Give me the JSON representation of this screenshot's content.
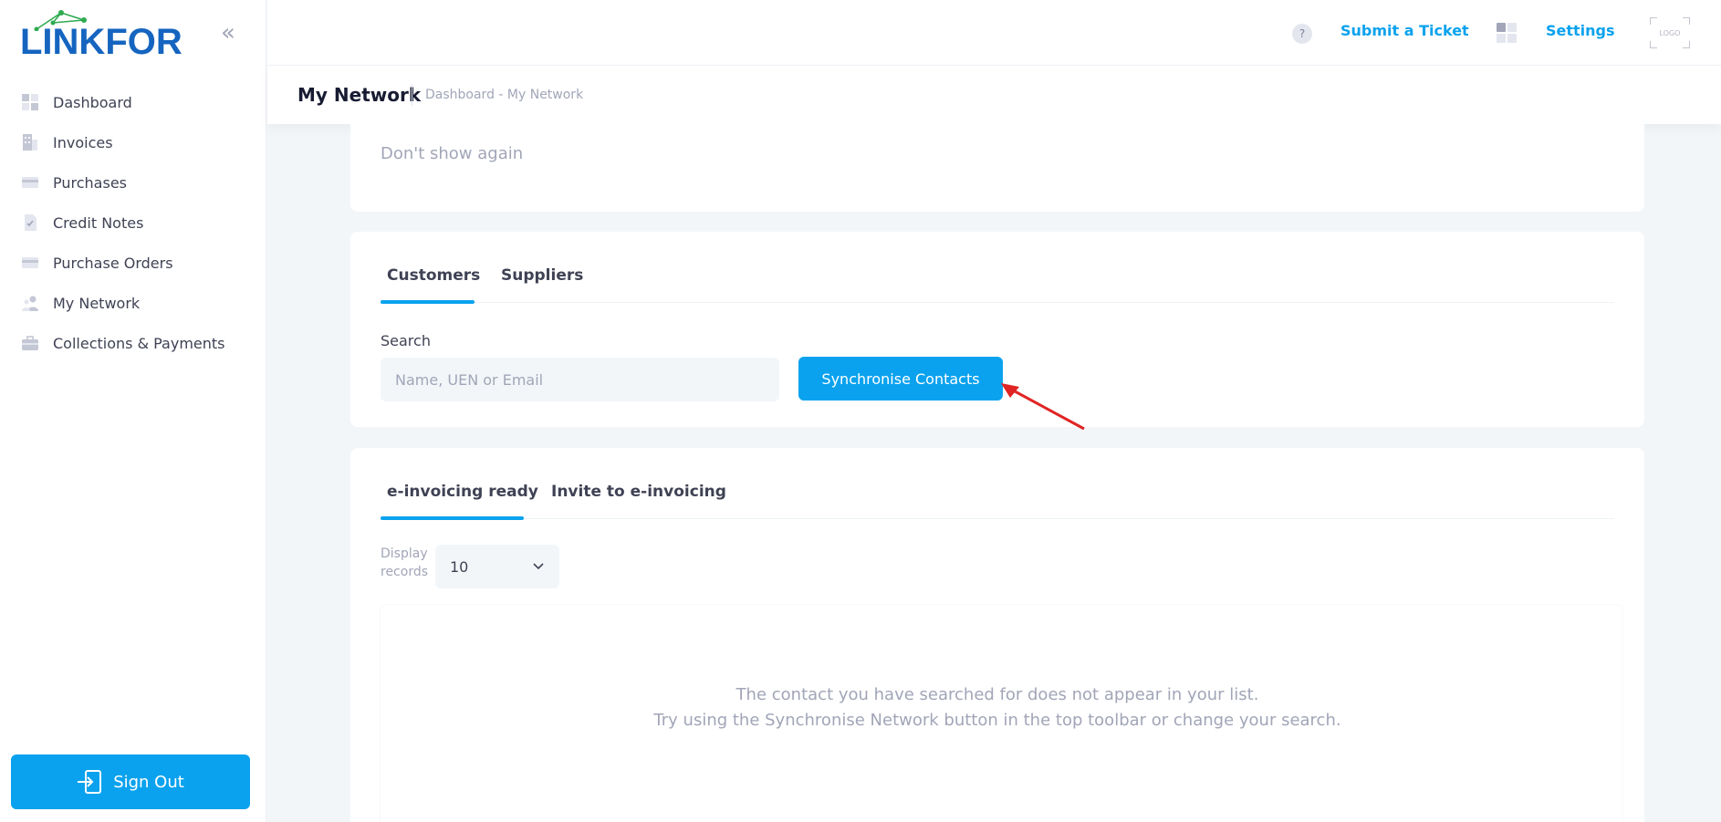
{
  "brand": {
    "name": "LINKFOR",
    "color": "#1565c0"
  },
  "sidebar": {
    "items": [
      {
        "label": "Dashboard",
        "icon": "dashboard-icon"
      },
      {
        "label": "Invoices",
        "icon": "invoice-icon"
      },
      {
        "label": "Purchases",
        "icon": "card-icon"
      },
      {
        "label": "Credit Notes",
        "icon": "document-check-icon"
      },
      {
        "label": "Purchase Orders",
        "icon": "card-icon"
      },
      {
        "label": "My Network",
        "icon": "users-icon"
      },
      {
        "label": "Collections & Payments",
        "icon": "briefcase-icon"
      }
    ],
    "sign_out": "Sign Out"
  },
  "header": {
    "help": "?",
    "submit_ticket": "Submit a Ticket",
    "settings": "Settings",
    "logo_placeholder": "LOGO"
  },
  "subheader": {
    "title": "My Network",
    "breadcrumb": "Dashboard - My Network"
  },
  "notice": {
    "dont_show": "Don't show again"
  },
  "contacts": {
    "tabs": [
      "Customers",
      "Suppliers"
    ],
    "active_tab": "Customers",
    "search_label": "Search",
    "search_placeholder": "Name, UEN or Email",
    "sync_button": "Synchronise Contacts"
  },
  "list": {
    "tabs": [
      "e-invoicing ready",
      "Invite to e-invoicing"
    ],
    "active_tab": "e-invoicing ready",
    "display_label_line1": "Display",
    "display_label_line2": "records",
    "records_value": "10",
    "empty_line1": "The contact you have searched for does not appear in your list.",
    "empty_line2": "Try using the Synchronise Network button in the top toolbar or change your search."
  },
  "colors": {
    "accent": "#0aa2ee",
    "annotation": "#e02424"
  }
}
